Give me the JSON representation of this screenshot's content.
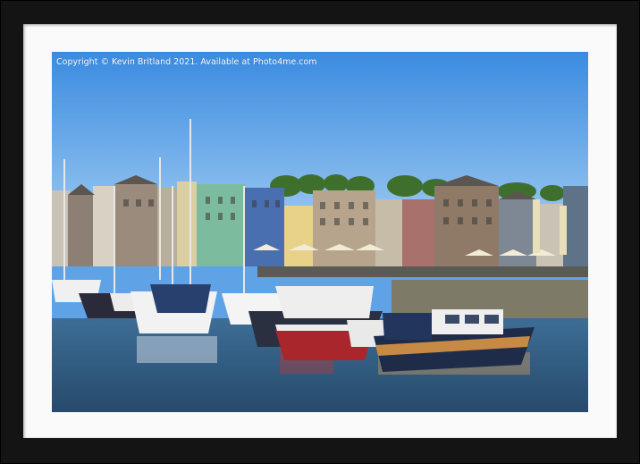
{
  "image": {
    "subject": "Harbour marina with moored boats in front of a row of waterfront buildings under a blue sky",
    "copyright_text": "Copyright © Kevin Britland 2021. Available at Photo4me.com",
    "colors": {
      "frame": "#141414",
      "mount": "#fafafa",
      "sky_top": "#3f8ee0",
      "sky_bottom": "#9fcaf2",
      "water": "#2f5a80"
    }
  }
}
